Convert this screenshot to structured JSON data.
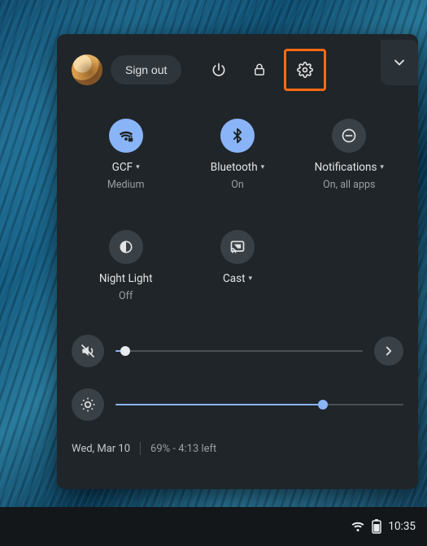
{
  "header": {
    "signout_label": "Sign out"
  },
  "tiles": {
    "wifi": {
      "label": "GCF",
      "sub": "Medium"
    },
    "bluetooth": {
      "label": "Bluetooth",
      "sub": "On"
    },
    "notifications": {
      "label": "Notifications",
      "sub": "On, all apps"
    },
    "nightlight": {
      "label": "Night Light",
      "sub": "Off"
    },
    "cast": {
      "label": "Cast",
      "sub": ""
    }
  },
  "sliders": {
    "volume": {
      "percent": 4
    },
    "brightness": {
      "percent": 72
    }
  },
  "footer": {
    "date": "Wed, Mar 10",
    "battery_text": "69% - 4:13 left"
  },
  "taskbar": {
    "time": "10:35"
  }
}
